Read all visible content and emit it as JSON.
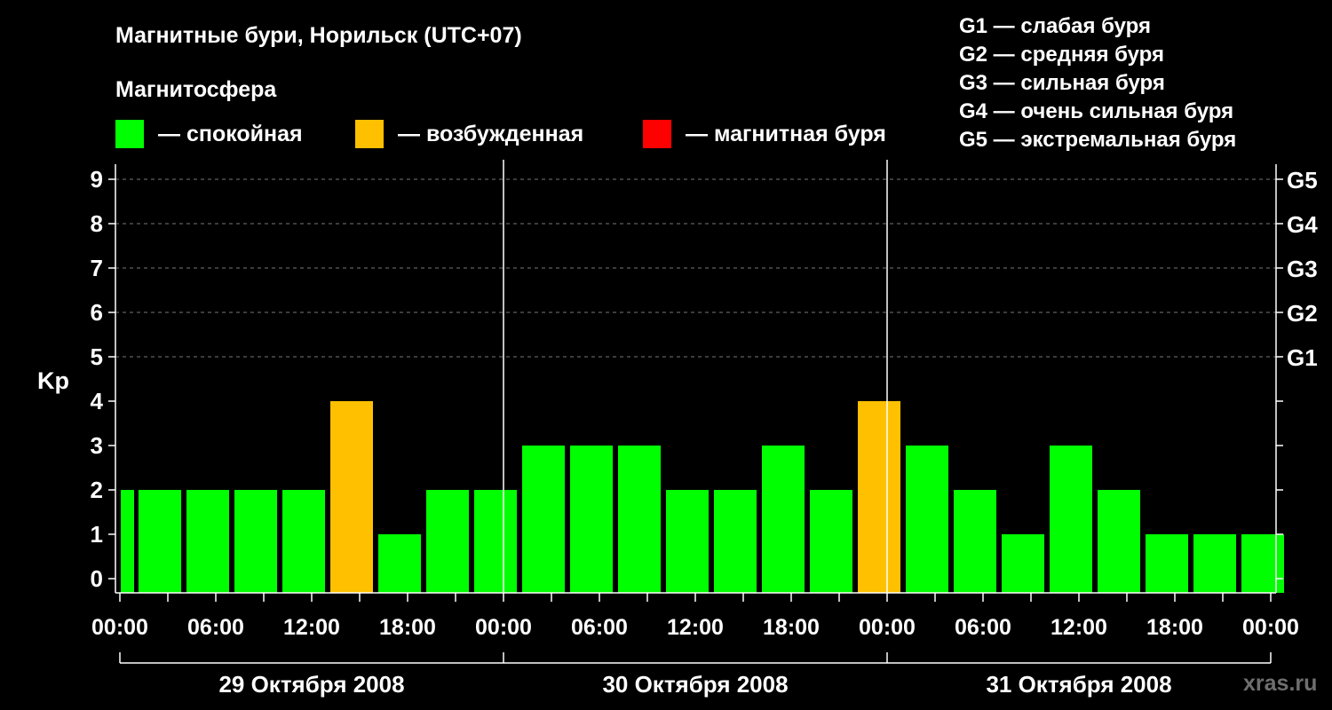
{
  "chart_data": {
    "type": "bar",
    "title": "Магнитные бури, Норильск (UTC+07)",
    "subtitle": "Магнитосфера",
    "ylabel": "Kp",
    "ylim": [
      0,
      9
    ],
    "yticks": [
      "0",
      "1",
      "2",
      "3",
      "4",
      "5",
      "6",
      "7",
      "8",
      "9"
    ],
    "g_levels": [
      {
        "kp": 5,
        "label": "G1"
      },
      {
        "kp": 6,
        "label": "G2"
      },
      {
        "kp": 7,
        "label": "G3"
      },
      {
        "kp": 8,
        "label": "G4"
      },
      {
        "kp": 9,
        "label": "G5"
      }
    ],
    "legend": [
      {
        "label": "— спокойная",
        "color": "#00ff00"
      },
      {
        "label": "— возбужденная",
        "color": "#ffc000"
      },
      {
        "label": "— магнитная буря",
        "color": "#ff0000"
      }
    ],
    "g_legend": [
      "G1 — слабая буря",
      "G2 — средняя буря",
      "G3 — сильная буря",
      "G4 — очень сильная буря",
      "G5 — экстремальная буря"
    ],
    "x_tick_labels": [
      "00:00",
      "06:00",
      "12:00",
      "18:00",
      "00:00",
      "06:00",
      "12:00",
      "18:00",
      "00:00",
      "06:00",
      "12:00",
      "18:00",
      "00:00"
    ],
    "dates": [
      "29 Октября 2008",
      "30 Октября 2008",
      "31 Октября 2008"
    ],
    "series": [
      {
        "values": [
          2,
          2,
          2,
          2,
          2,
          4,
          1,
          2,
          2,
          3,
          3,
          3,
          2,
          2,
          3,
          2,
          4,
          3,
          2,
          1,
          3,
          2,
          1,
          1,
          1
        ],
        "status": [
          "quiet",
          "quiet",
          "quiet",
          "quiet",
          "quiet",
          "active",
          "quiet",
          "quiet",
          "quiet",
          "quiet",
          "quiet",
          "quiet",
          "quiet",
          "quiet",
          "quiet",
          "quiet",
          "active",
          "quiet",
          "quiet",
          "quiet",
          "quiet",
          "quiet",
          "quiet",
          "quiet",
          "quiet"
        ]
      }
    ],
    "grid": true,
    "watermark": "xras.ru"
  }
}
